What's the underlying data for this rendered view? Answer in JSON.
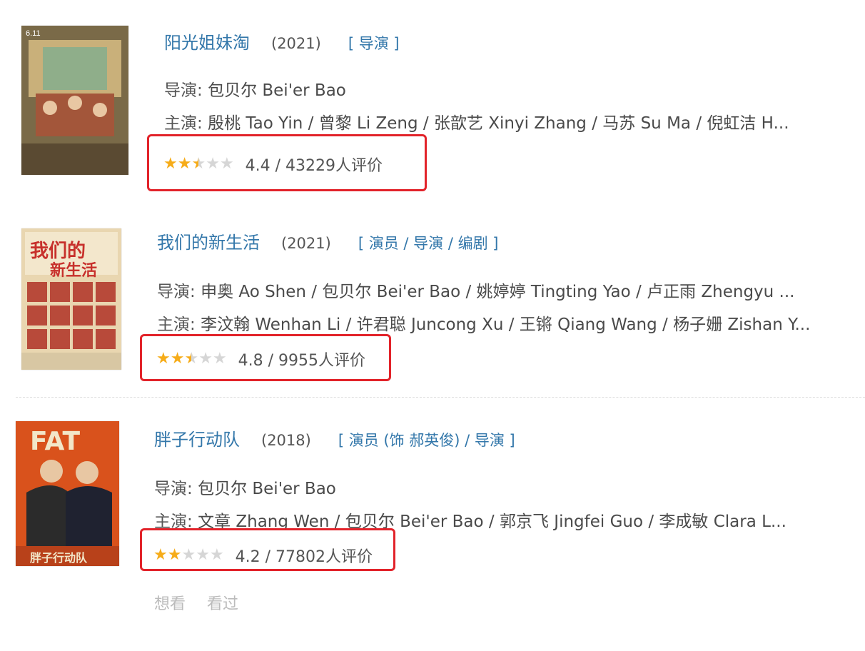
{
  "movies": [
    {
      "title": "阳光姐妹淘",
      "year": "(2021)",
      "roles": "[ 导演 ]",
      "director_label": "导演:",
      "director": "包贝尔 Bei'er Bao",
      "cast_label": "主演:",
      "cast": "殷桃 Tao Yin / 曾黎 Li Zeng / 张歆艺 Xinyi Zhang / 马苏 Su Ma / 倪虹洁 H...",
      "stars": 2.5,
      "rating_text": "4.4 / 43229人评价",
      "poster_colors": [
        "#6b5a3a",
        "#c9b07a",
        "#8a3b2c"
      ]
    },
    {
      "title": "我们的新生活",
      "year": "(2021)",
      "roles": "[ 演员 / 导演 / 编剧 ]",
      "director_label": "导演:",
      "director": "申奥 Ao Shen / 包贝尔 Bei'er Bao / 姚婷婷 Tingting Yao / 卢正雨 Zhengyu ...",
      "cast_label": "主演:",
      "cast": "李汶翰 Wenhan Li / 许君聪 Juncong Xu / 王锵 Qiang Wang / 杨子姗 Zishan Y...",
      "stars": 2.5,
      "rating_text": "4.8 / 9955人评价",
      "poster_colors": [
        "#c7302b",
        "#e9d6b0",
        "#5a2a1c"
      ]
    },
    {
      "title": "胖子行动队",
      "year": "(2018)",
      "roles": "[ 演员 (饰 郝英俊) / 导演 ]",
      "director_label": "导演:",
      "director": "包贝尔 Bei'er Bao",
      "cast_label": "主演:",
      "cast": "文章 Zhang Wen / 包贝尔 Bei'er Bao / 郭京飞 Jingfei Guo / 李成敏 Clara L...",
      "stars": 2,
      "rating_text": "4.2 / 77802人评价",
      "poster_colors": [
        "#d9521c",
        "#2b2b2b",
        "#f2e6c8"
      ]
    }
  ],
  "actions": {
    "want": "想看",
    "seen": "看过"
  },
  "colors": {
    "accent": "#3377aa",
    "highlight_box": "#e2232a",
    "star": "#f6ac19"
  }
}
